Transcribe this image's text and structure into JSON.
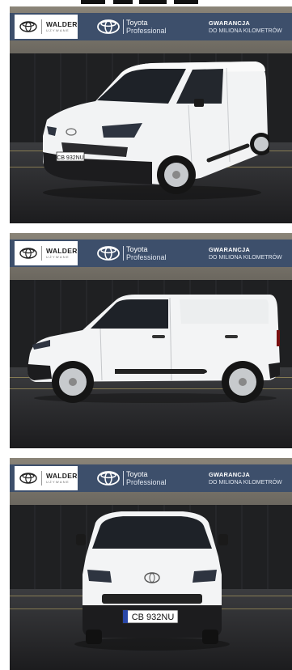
{
  "banner": {
    "dealer_name": "WALDER",
    "dealer_subtitle": "UŻYWANE",
    "brand_line1": "Toyota",
    "brand_line2": "Professional",
    "guarantee_line1": "GWARANCJA",
    "guarantee_line2": "DO MILIONA KILOMETRÓW"
  },
  "photos": [
    {
      "view": "front-three-quarter",
      "plate": "CB 932NU"
    },
    {
      "view": "side",
      "plate": ""
    },
    {
      "view": "front",
      "plate": "CB 932NU"
    }
  ],
  "colors": {
    "banner": "#3d4f6b",
    "van_body": "#f4f5f6"
  }
}
